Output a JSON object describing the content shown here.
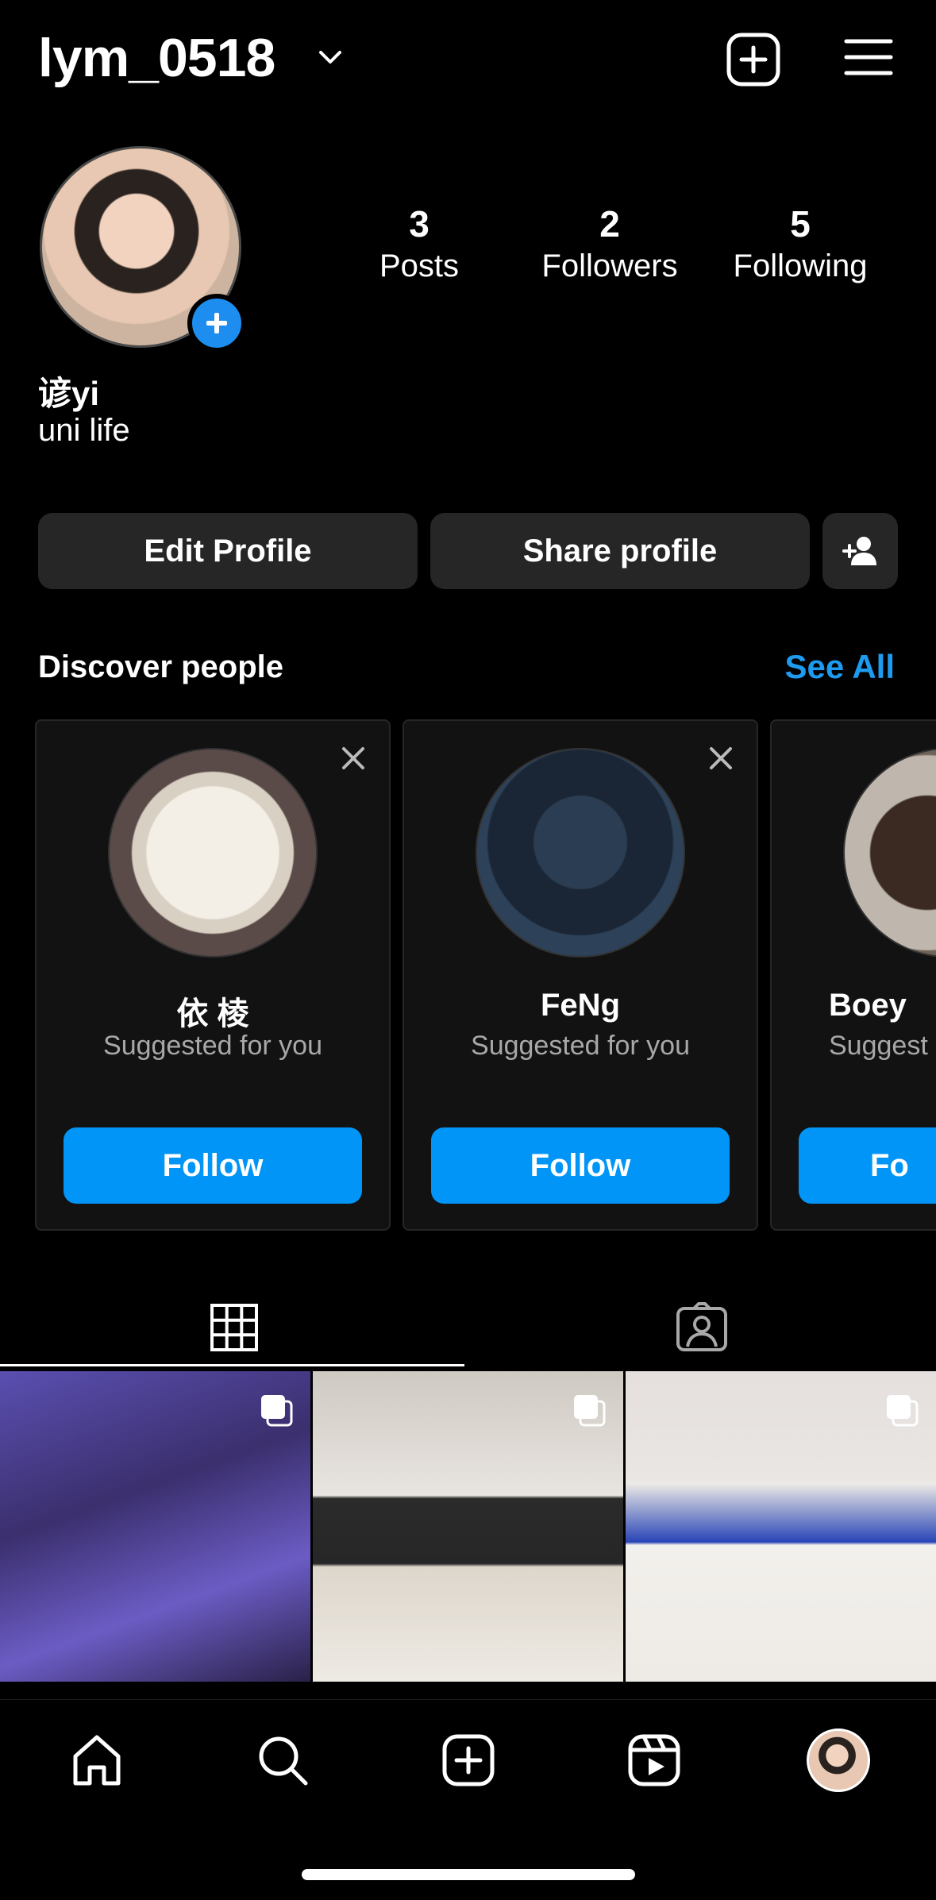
{
  "header": {
    "username": "lym_0518",
    "icons": [
      "chevron-down-icon",
      "create-post-icon",
      "menu-icon"
    ]
  },
  "profile": {
    "full_name": "谚yi",
    "bio": "uni life",
    "stats": {
      "posts_count": "3",
      "posts_label": "Posts",
      "followers_count": "2",
      "followers_label": "Followers",
      "following_count": "5",
      "following_label": "Following"
    },
    "buttons": {
      "edit": "Edit Profile",
      "share": "Share profile"
    }
  },
  "discover": {
    "title": "Discover people",
    "see_all": "See All",
    "cards": [
      {
        "name": "依 棱",
        "subtitle": "Suggested for you",
        "button": "Follow"
      },
      {
        "name": "FeNg",
        "subtitle": "Suggested for you",
        "button": "Follow"
      },
      {
        "name": "Boey",
        "subtitle": "Suggest",
        "button": "Fo"
      }
    ]
  },
  "tabs": [
    "grid-icon",
    "tagged-icon"
  ],
  "posts": [
    {
      "type": "carousel"
    },
    {
      "type": "carousel"
    },
    {
      "type": "carousel"
    }
  ],
  "nav": [
    "home-icon",
    "search-icon",
    "create-icon",
    "reels-icon",
    "profile-avatar"
  ],
  "colors": {
    "accent": "#0095f6",
    "link": "#1d9bf0",
    "button_bg": "#262626",
    "background": "#000000"
  }
}
